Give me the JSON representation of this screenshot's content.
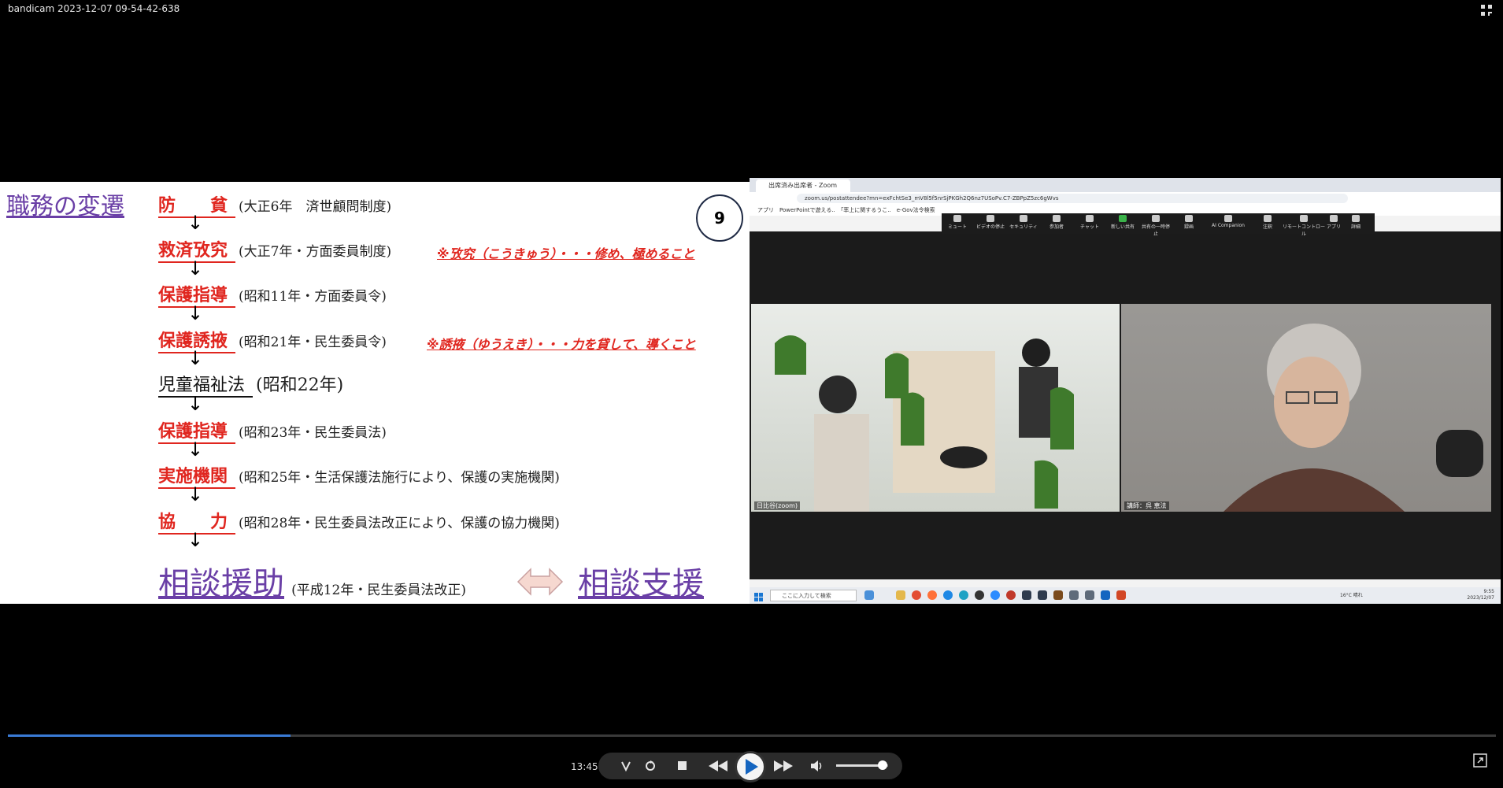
{
  "window": {
    "title": "bandicam 2023-12-07 09-54-42-638"
  },
  "slide": {
    "title": "職務の変遷",
    "page_number": "9",
    "rows": [
      {
        "keyword": "防　　貧",
        "desc": "(大正6年　済世顧問制度)"
      },
      {
        "keyword": "救済攷究",
        "desc": "(大正7年・方面委員制度)",
        "note": "※攷究（こうきゅう）・・・修め、極めること"
      },
      {
        "keyword": "保護指導",
        "desc": "(昭和11年・方面委員令)"
      },
      {
        "keyword": "保護誘掖",
        "desc": "(昭和21年・民生委員令)",
        "note": "※誘掖（ゆうえき）・・・力を貸して、導くこと"
      },
      {
        "keyword": "児童福祉法",
        "desc": "(昭和22年)"
      },
      {
        "keyword": "保護指導",
        "desc": "(昭和23年・民生委員法)"
      },
      {
        "keyword": "実施機関",
        "desc": "(昭和25年・生活保護法施行により、保護の実施機関)"
      },
      {
        "keyword": "協　　力",
        "desc": "(昭和28年・民生委員法改正により、保護の協力機関)"
      }
    ],
    "final": {
      "left": "相談援助",
      "desc": "(平成12年・民生委員法改正)",
      "right": "相談支援"
    },
    "arrow_glyph": "↓"
  },
  "zoom": {
    "tab_title": "出席済み出席者 - Zoom",
    "url": "zoom.us/postattendee?mn=exFchtSe3_mV8l5f5nrSjPKGh2Q6nz7USoPv.C7-ZBPpZ5zc6gWvs",
    "bookmarks": "アプリ　PowerPointで遊える..　「率上に関するうこ..　e-Gov法令検索",
    "toolbar": [
      "ミュート",
      "ビデオの停止",
      "セキュリティ",
      "参加者",
      "チャット",
      "新しい共有",
      "共有の一時停止",
      "録画",
      "AI Companion",
      "注釈",
      "リモートコントロール",
      "アプリ",
      "詳細"
    ],
    "participants": [
      {
        "label": "日比谷(zoom)"
      },
      {
        "label": "講師：呉 恵法"
      }
    ],
    "taskbar_search": "ここに入力して検索",
    "weather": "16°C 晴れ",
    "clock_time": "9:55",
    "clock_date": "2023/12/07"
  },
  "player": {
    "time": "13:45",
    "progress": 0.19,
    "volume": 0.9,
    "colors": {
      "accent": "#3a7bd5"
    }
  }
}
